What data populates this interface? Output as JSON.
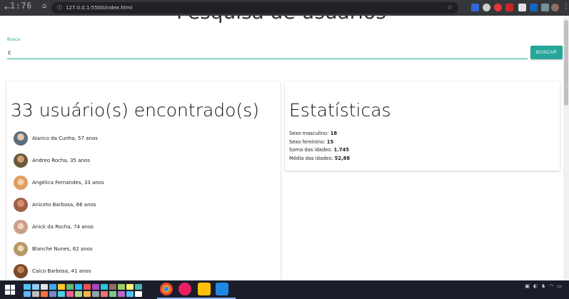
{
  "browser": {
    "counter": "1:76",
    "url": "127.0.0.1:5500/index.html"
  },
  "page": {
    "title_partial": "Pesquisa de usuários"
  },
  "search": {
    "label": "Busca",
    "value": "c",
    "button_label": "BUSCAR"
  },
  "users_card": {
    "heading": "33 usuário(s) encontrado(s)",
    "users": [
      {
        "name": "Alarico da Cunha, 57 anos",
        "color": "#5a6e7e"
      },
      {
        "name": "Andreo Rocha, 35 anos",
        "color": "#6b5a3a"
      },
      {
        "name": "Angélica Fernandes, 33 anos",
        "color": "#e0a060"
      },
      {
        "name": "Aniceto Barbosa, 66 anos",
        "color": "#a0604a"
      },
      {
        "name": "Anick da Rocha, 74 anos",
        "color": "#c9a08a"
      },
      {
        "name": "Blanche Nunes, 62 anos",
        "color": "#b89a6a"
      },
      {
        "name": "Caíco Barbosa, 41 anos",
        "color": "#7a4a2a"
      }
    ]
  },
  "stats_card": {
    "heading": "Estatísticas",
    "male_label": "Sexo masculino:",
    "male_value": "18",
    "female_label": "Sexo feminino:",
    "female_value": "15",
    "sum_label": "Soma das idades:",
    "sum_value": "1.745",
    "avg_label": "Média das idades:",
    "avg_value": "52,88"
  },
  "colors": {
    "accent": "#26a69a",
    "chrome": "#35363a",
    "taskbar": "#1b1e2a"
  }
}
